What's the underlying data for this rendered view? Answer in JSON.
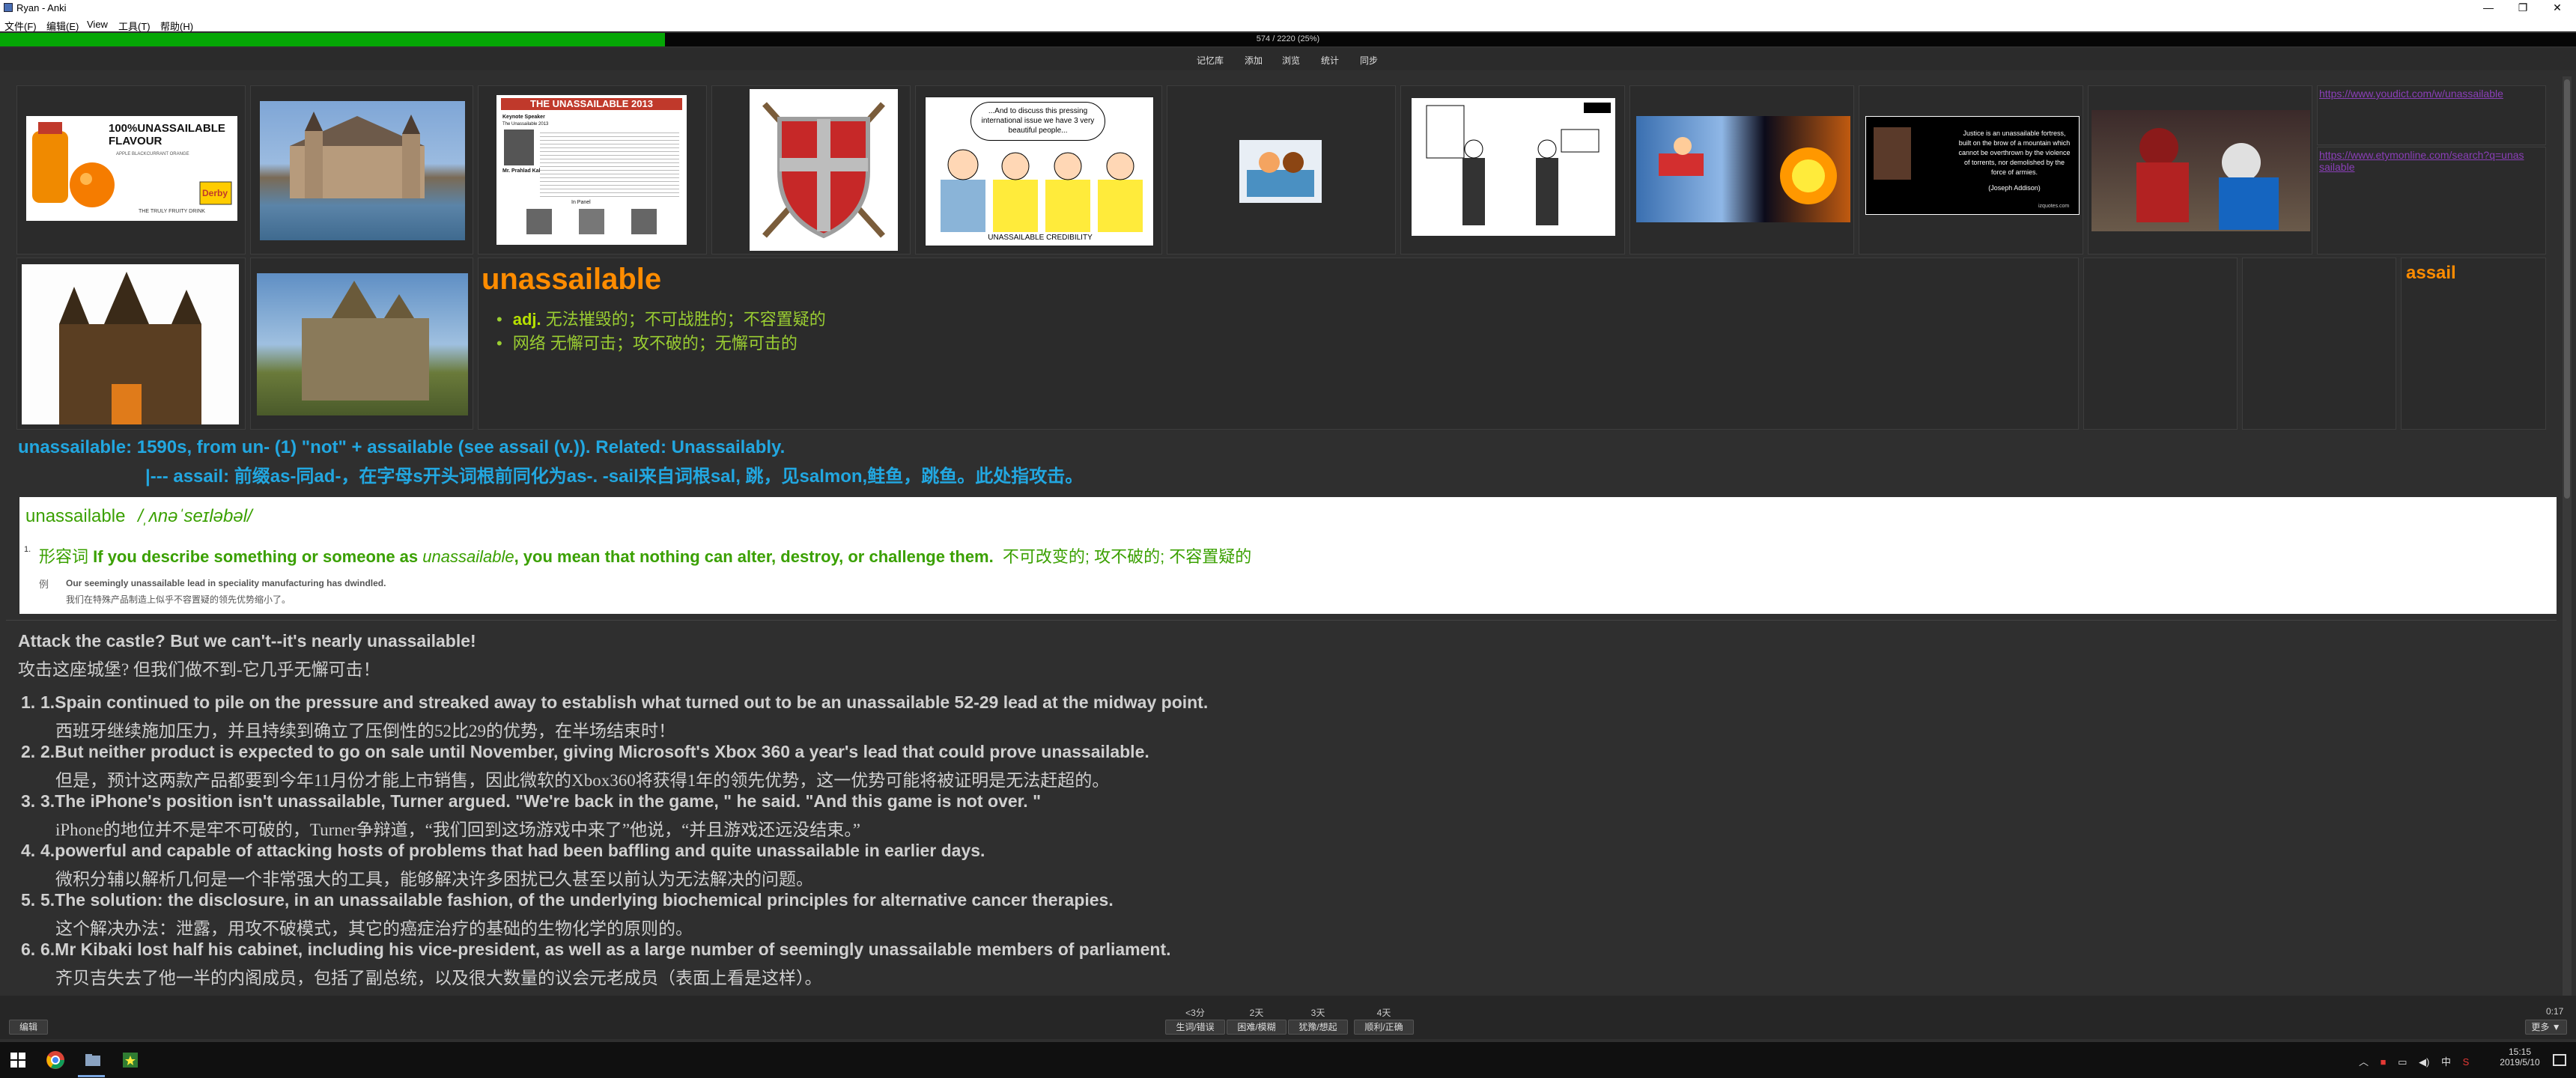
{
  "window": {
    "title": "Ryan - Anki",
    "controls": [
      "—",
      "❐",
      "✕"
    ]
  },
  "menu": [
    "文件(F)",
    "编辑(E)",
    "View",
    "工具(T)",
    "帮助(H)"
  ],
  "progress": {
    "text": "574 / 2220 (25%)",
    "fraction": 0.258
  },
  "toolbar": [
    "记忆库",
    "添加",
    "浏览",
    "统计",
    "同步"
  ],
  "image_texts": {
    "juice_slogan": "100%UNASSAILABLE FLAVOUR",
    "juice_brand": "Derby",
    "juice_tag": "THE TRULY FRUITY DRINK",
    "juice_sub": "APPLE BLACKCURRANT ORANGE",
    "paper_title": "THE UNASSAILABLE 2013",
    "paper_sub1": "Keynote Speaker",
    "paper_sub2": "The Unassailable 2013",
    "paper_person": "Mr. Prahlad Kakkar",
    "paper_inpanel": "In Panel",
    "comic_bubble": "...And to discuss this pressing international issue we have 3 very beautiful people...",
    "comic_caption": "UNASSAILABLE CREDIBILITY",
    "quote_text": "Justice is an unassailable fortress, built on the brow of a mountain which cannot be overthrown by the violence of torrents, nor demolished by the force of armies.",
    "quote_author": "(Joseph Addison)",
    "quote_site": "izquotes.com"
  },
  "links": {
    "youdict": "https://www.youdict.com/w/unassailable",
    "etymonline": "https://www.etymonline.com/search?q=unassailable"
  },
  "word": "unassailable",
  "root": "assail",
  "definitions": [
    {
      "pos": "adj.",
      "text": "无法摧毁的；不可战胜的；不容置疑的"
    },
    {
      "pos": "",
      "text": "网络 无懈可击；攻不破的；无懈可击的"
    }
  ],
  "etymology": {
    "line1": "unassailable: 1590s, from un- (1) \"not\" + assailable (see assail (v.)). Related: Unassailably.",
    "line2": "|--- assail: 前缀as-同ad-，在字母s开头词根前同化为as-. -sail来自词根sal, 跳，见salmon,鲑鱼，跳鱼。此处指攻击。"
  },
  "dict": {
    "headword": "unassailable",
    "phonetic": "/ˌʌnəˈseɪləbəl/",
    "num": "1.",
    "pos_cn": "形容词",
    "def_pre": "If you describe something or someone as ",
    "def_em": "unassailable",
    "def_post": ", you mean that nothing can alter, destroy, or challenge them.",
    "def_cn": "不可改变的; 攻不破的; 不容置疑的",
    "ex_label": "例",
    "ex_en": "Our seemingly unassailable lead in speciality manufacturing has dwindled.",
    "ex_cn": "我们在特殊产品制造上似乎不容置疑的领先优势缩小了。"
  },
  "sentences": {
    "intro_en": "Attack the castle? But we can't--it's nearly unassailable!",
    "intro_cn": "攻击这座城堡? 但我们做不到-它几乎无懈可击！",
    "items": [
      {
        "num": "1.",
        "en": "1.Spain continued to pile on the pressure and streaked away to establish what turned out to be an unassailable 52-29 lead at the midway point.",
        "cn": "西班牙继续施加压力，并且持续到确立了压倒性的52比29的优势，在半场结束时！"
      },
      {
        "num": "2.",
        "en": "2.But neither product is expected to go on sale until November, giving Microsoft's Xbox 360 a year's lead that could prove unassailable.",
        "cn": "但是，预计这两款产品都要到今年11月份才能上市销售，因此微软的Xbox360将获得1年的领先优势，这一优势可能将被证明是无法赶超的。"
      },
      {
        "num": "3.",
        "en": "3.The iPhone's position isn't unassailable, Turner argued. \"We're back in the game, \" he said. \"And this game is not over. \"",
        "cn": "iPhone的地位并不是牢不可破的，Turner争辩道，“我们回到这场游戏中来了”他说，“并且游戏还远没结束。”"
      },
      {
        "num": "4.",
        "en": "4.powerful and capable of attacking hosts of problems that had been baffling and quite unassailable in earlier days.",
        "cn": "微积分辅以解析几何是一个非常强大的工具，能够解决许多困扰已久甚至以前认为无法解决的问题。"
      },
      {
        "num": "5.",
        "en": "5.The solution: the disclosure, in an unassailable fashion, of the underlying biochemical principles for alternative cancer therapies.",
        "cn": "这个解决办法：泄露，用攻不破模式，其它的癌症治疗的基础的生物化学的原则的。"
      },
      {
        "num": "6.",
        "en": "6.Mr Kibaki lost half his cabinet, including his vice-president, as well as a large number of seemingly unassailable members of parliament.",
        "cn": "齐贝吉失去了他一半的内阁成员，包括了副总统，以及很大数量的议会元老成员（表面上看是这样）。"
      }
    ]
  },
  "bottom": {
    "edit": "编辑",
    "more": "更多 ▼",
    "timer": "0:17",
    "answers": [
      {
        "time": "<3分",
        "label": "生词/错误"
      },
      {
        "time": "2天",
        "label": "困难/模糊"
      },
      {
        "time": "3天",
        "label": "犹豫/想起"
      },
      {
        "time": "4天",
        "label": "顺利/正确"
      }
    ]
  },
  "taskbar": {
    "time": "15:15",
    "date": "2019/5/10",
    "ime": "中"
  }
}
